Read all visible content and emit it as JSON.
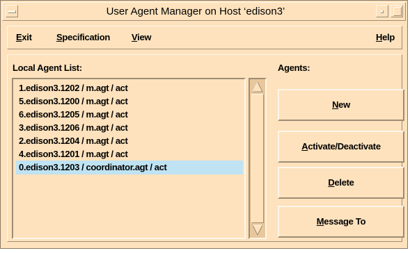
{
  "window": {
    "title": "User Agent Manager on Host ‘edison3’"
  },
  "menubar": {
    "items": [
      {
        "mnemonic": "E",
        "rest": "xit"
      },
      {
        "mnemonic": "S",
        "rest": "pecification"
      },
      {
        "mnemonic": "V",
        "rest": "iew"
      }
    ],
    "help": {
      "mnemonic": "H",
      "rest": "elp"
    }
  },
  "local_list": {
    "label": "Local Agent List:",
    "items": [
      "1.edison3.1202 / m.agt / act",
      "5.edison3.1200 / m.agt / act",
      "6.edison3.1205 / m.agt / act",
      "3.edison3.1206 / m.agt / act",
      "2.edison3.1204 / m.agt / act",
      "4.edison3.1201 / m.agt / act",
      "0.edison3.1203 / coordinator.agt / act"
    ],
    "selected_index": 6
  },
  "agents": {
    "label": "Agents:",
    "buttons": [
      {
        "mnemonic": "N",
        "rest": "ew"
      },
      {
        "mnemonic": "A",
        "rest": "ctivate/Deactivate"
      },
      {
        "mnemonic": "D",
        "rest": "elete"
      },
      {
        "mnemonic": "M",
        "rest": "essage To"
      }
    ]
  },
  "colors": {
    "background": "#fde2bd",
    "selection": "#bfe3f2",
    "shadow": "#9d8c74",
    "highlight": "#fff6e8"
  }
}
